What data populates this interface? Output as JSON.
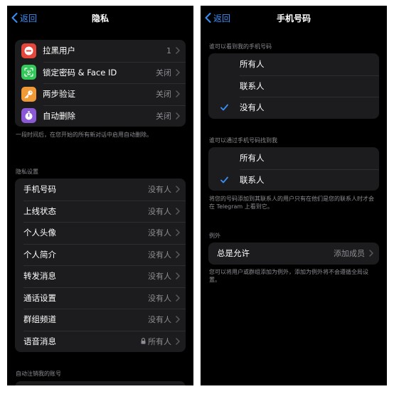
{
  "colors": {
    "background": "#000000",
    "cell": "#1c1c1e",
    "accent": "#3a8ef6",
    "secondary_text": "#8d8d93"
  },
  "left_screen": {
    "back_label": "返回",
    "title": "隐私",
    "top_items": [
      {
        "label": "拉黑用户",
        "value": "1",
        "icon": "block-icon",
        "icon_color": "#e5463b"
      },
      {
        "label": "锁定密码 & Face ID",
        "value": "关闭",
        "icon": "face-id-icon",
        "icon_color": "#34c759"
      },
      {
        "label": "两步验证",
        "value": "关闭",
        "icon": "key-icon",
        "icon_color": "#f09a37"
      },
      {
        "label": "自动删除",
        "value": "关闭",
        "icon": "timer-icon",
        "icon_color": "#8c59d6"
      }
    ],
    "auto_delete_note": "一段时间后，在您开始的所有新对话中启用自动删除。",
    "privacy_header": "隐私设置",
    "privacy_items": [
      {
        "label": "手机号码",
        "value": "没有人"
      },
      {
        "label": "上线状态",
        "value": "没有人"
      },
      {
        "label": "个人头像",
        "value": "没有人"
      },
      {
        "label": "个人简介",
        "value": "没有人"
      },
      {
        "label": "转发消息",
        "value": "没有人"
      },
      {
        "label": "通话设置",
        "value": "没有人"
      },
      {
        "label": "群组频道",
        "value": "没有人"
      },
      {
        "label": "语音消息",
        "value": "所有人",
        "value_icon": "lock-icon"
      }
    ],
    "bottom_header": "自动注销我的账号"
  },
  "right_screen": {
    "back_label": "返回",
    "title": "手机号码",
    "see_header": "谁可以看到我的手机号码",
    "see_options": [
      {
        "label": "所有人",
        "selected": false
      },
      {
        "label": "联系人",
        "selected": false
      },
      {
        "label": "没有人",
        "selected": true
      }
    ],
    "find_header": "谁可以通过手机号码找到我",
    "find_options": [
      {
        "label": "所有人",
        "selected": false
      },
      {
        "label": "联系人",
        "selected": true
      }
    ],
    "find_note": "将您的号码添加到其联系人的用户只有在他们是您的联系人时才会在 Telegram 上看到它。",
    "exceptions_header": "例外",
    "exception_item": {
      "label": "总是允许",
      "value": "添加成员"
    },
    "exceptions_note": "您可以将用户或群组添加为例外，添加为例外将不会遵循全局设置。"
  }
}
